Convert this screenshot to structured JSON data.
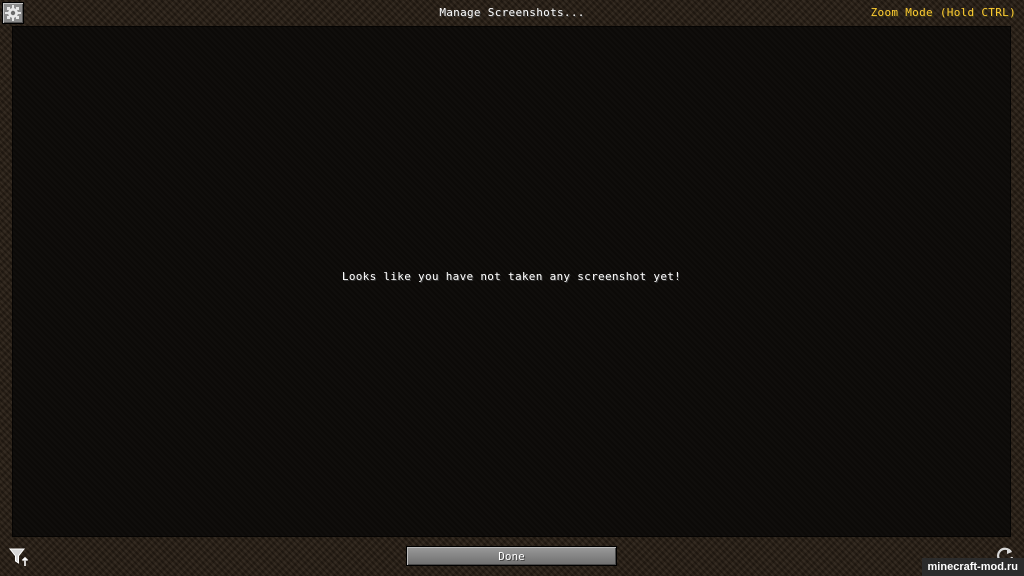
{
  "header": {
    "title": "Manage Screenshots...",
    "zoom_mode_label": "Zoom Mode (Hold CTRL)",
    "settings_icon": "gear-icon"
  },
  "main": {
    "empty_message": "Looks like you have not taken any screenshot yet!"
  },
  "footer": {
    "done_label": "Done",
    "filter_icon": "filter-sort-icon",
    "refresh_icon": "refresh-icon"
  },
  "watermark": {
    "text": "minecraft-mod.ru"
  },
  "colors": {
    "title_text": "#ffffff",
    "zoom_mode_text": "#ffcc33",
    "list_background": "#0d0b09",
    "border_background": "#2a2016",
    "button_face": "#8b8b8b"
  }
}
